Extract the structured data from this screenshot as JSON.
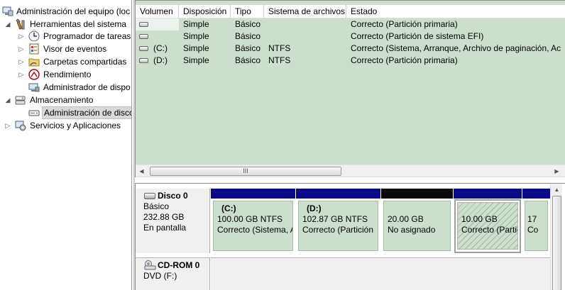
{
  "tree": {
    "root": {
      "label": "Administración del equipo (loc",
      "icon": "computer-management-icon"
    },
    "tools": {
      "label": "Herramientas del sistema",
      "icon": "tools-icon",
      "expanded": true
    },
    "scheduler": {
      "label": "Programador de tareas",
      "icon": "clock-icon"
    },
    "events": {
      "label": "Visor de eventos",
      "icon": "event-viewer-icon"
    },
    "shares": {
      "label": "Carpetas compartidas",
      "icon": "shared-folder-icon"
    },
    "performance": {
      "label": "Rendimiento",
      "icon": "performance-icon"
    },
    "devices": {
      "label": "Administrador de dispo",
      "icon": "device-manager-icon"
    },
    "storage": {
      "label": "Almacenamiento",
      "icon": "storage-icon",
      "expanded": true
    },
    "diskmgmt": {
      "label": "Administración de disco",
      "icon": "disk-management-icon",
      "selected": true
    },
    "services": {
      "label": "Servicios y Aplicaciones",
      "icon": "services-icon"
    }
  },
  "volumes": {
    "columns": [
      "Volumen",
      "Disposición",
      "Tipo",
      "Sistema de archivos",
      "Estado"
    ],
    "rows": [
      {
        "volume": "",
        "layout": "Simple",
        "type": "Básico",
        "fs": "",
        "status": "Correcto (Partición primaria)"
      },
      {
        "volume": "",
        "layout": "Simple",
        "type": "Básico",
        "fs": "",
        "status": "Correcto (Partición de sistema EFI)"
      },
      {
        "volume": "(C:)",
        "layout": "Simple",
        "type": "Básico",
        "fs": "NTFS",
        "status": "Correcto (Sistema, Arranque, Archivo de paginación, Ac"
      },
      {
        "volume": "(D:)",
        "layout": "Simple",
        "type": "Básico",
        "fs": "NTFS",
        "status": "Correcto (Partición primaria)"
      }
    ],
    "scroll_grip": "III"
  },
  "disks": {
    "disk0": {
      "name": "Disco 0",
      "kind": "Básico",
      "size": "232.88 GB",
      "state": "En pantalla",
      "partitions": [
        {
          "vol": "(C:)",
          "size": "100.00 GB NTFS",
          "status": "Correcto (Sistema, A",
          "bar": "blue"
        },
        {
          "vol": "(D:)",
          "size": "102.87 GB NTFS",
          "status": "Correcto (Partición",
          "bar": "blue"
        },
        {
          "vol": "",
          "size": "20.00 GB",
          "status": "No asignado",
          "bar": "black"
        },
        {
          "vol": "",
          "size": "10.00 GB",
          "status": "Correcto (Partic",
          "bar": "blue",
          "hatched": true
        },
        {
          "vol": "",
          "size": "17",
          "status": "Co",
          "bar": "blue"
        }
      ]
    },
    "cdrom0": {
      "name": "CD-ROM 0",
      "drive": "DVD (F:)"
    }
  },
  "colors": {
    "volume_bg": "#ccdfcc",
    "primary_bar": "#0a0a86",
    "unallocated_bar": "#0a0a0a"
  }
}
